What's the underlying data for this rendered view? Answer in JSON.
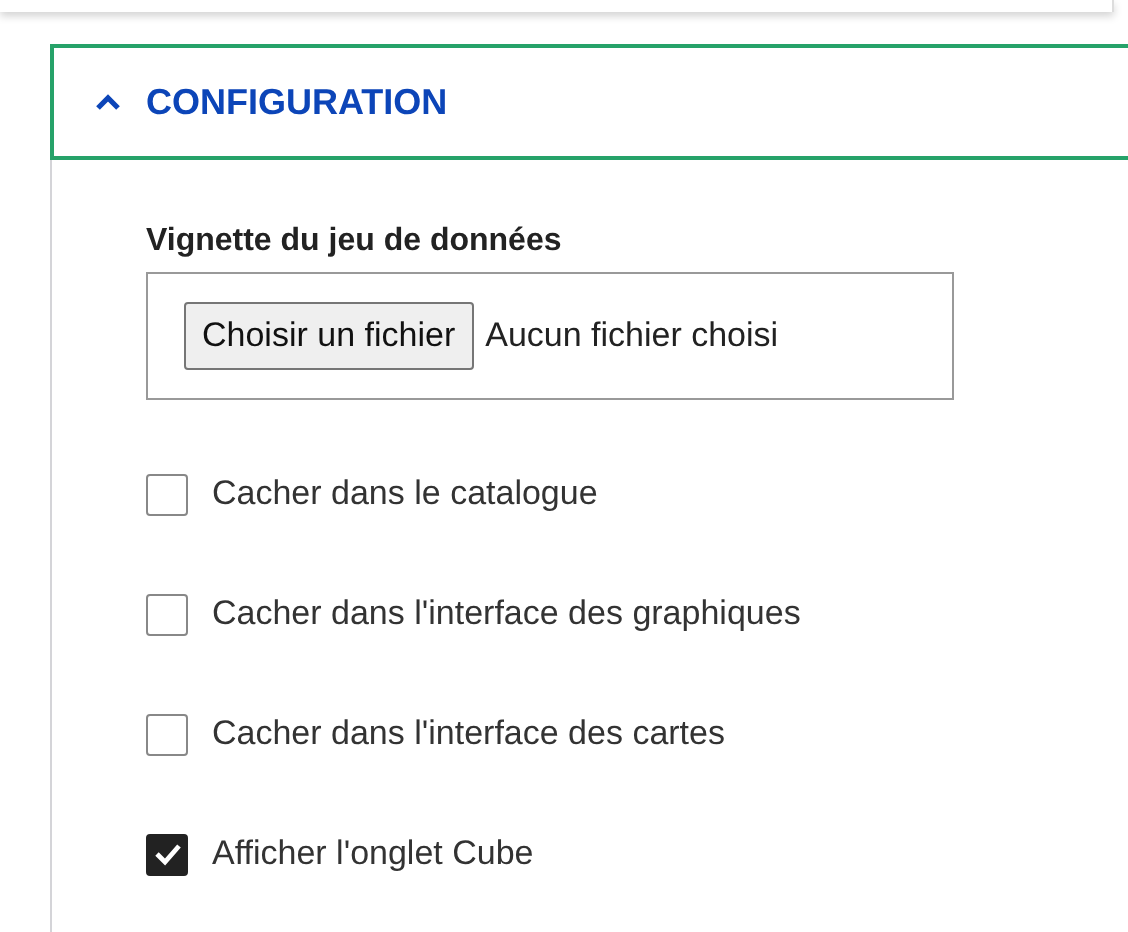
{
  "section": {
    "title": "CONFIGURATION",
    "expanded": true
  },
  "thumbnail": {
    "label": "Vignette du jeu de données",
    "button": "Choisir un fichier",
    "status": "Aucun fichier choisi"
  },
  "options": [
    {
      "label": "Cacher dans le catalogue",
      "checked": false
    },
    {
      "label": "Cacher dans l'interface des graphiques",
      "checked": false
    },
    {
      "label": "Cacher dans l'interface des cartes",
      "checked": false
    },
    {
      "label": "Afficher l'onglet Cube",
      "checked": true
    }
  ]
}
